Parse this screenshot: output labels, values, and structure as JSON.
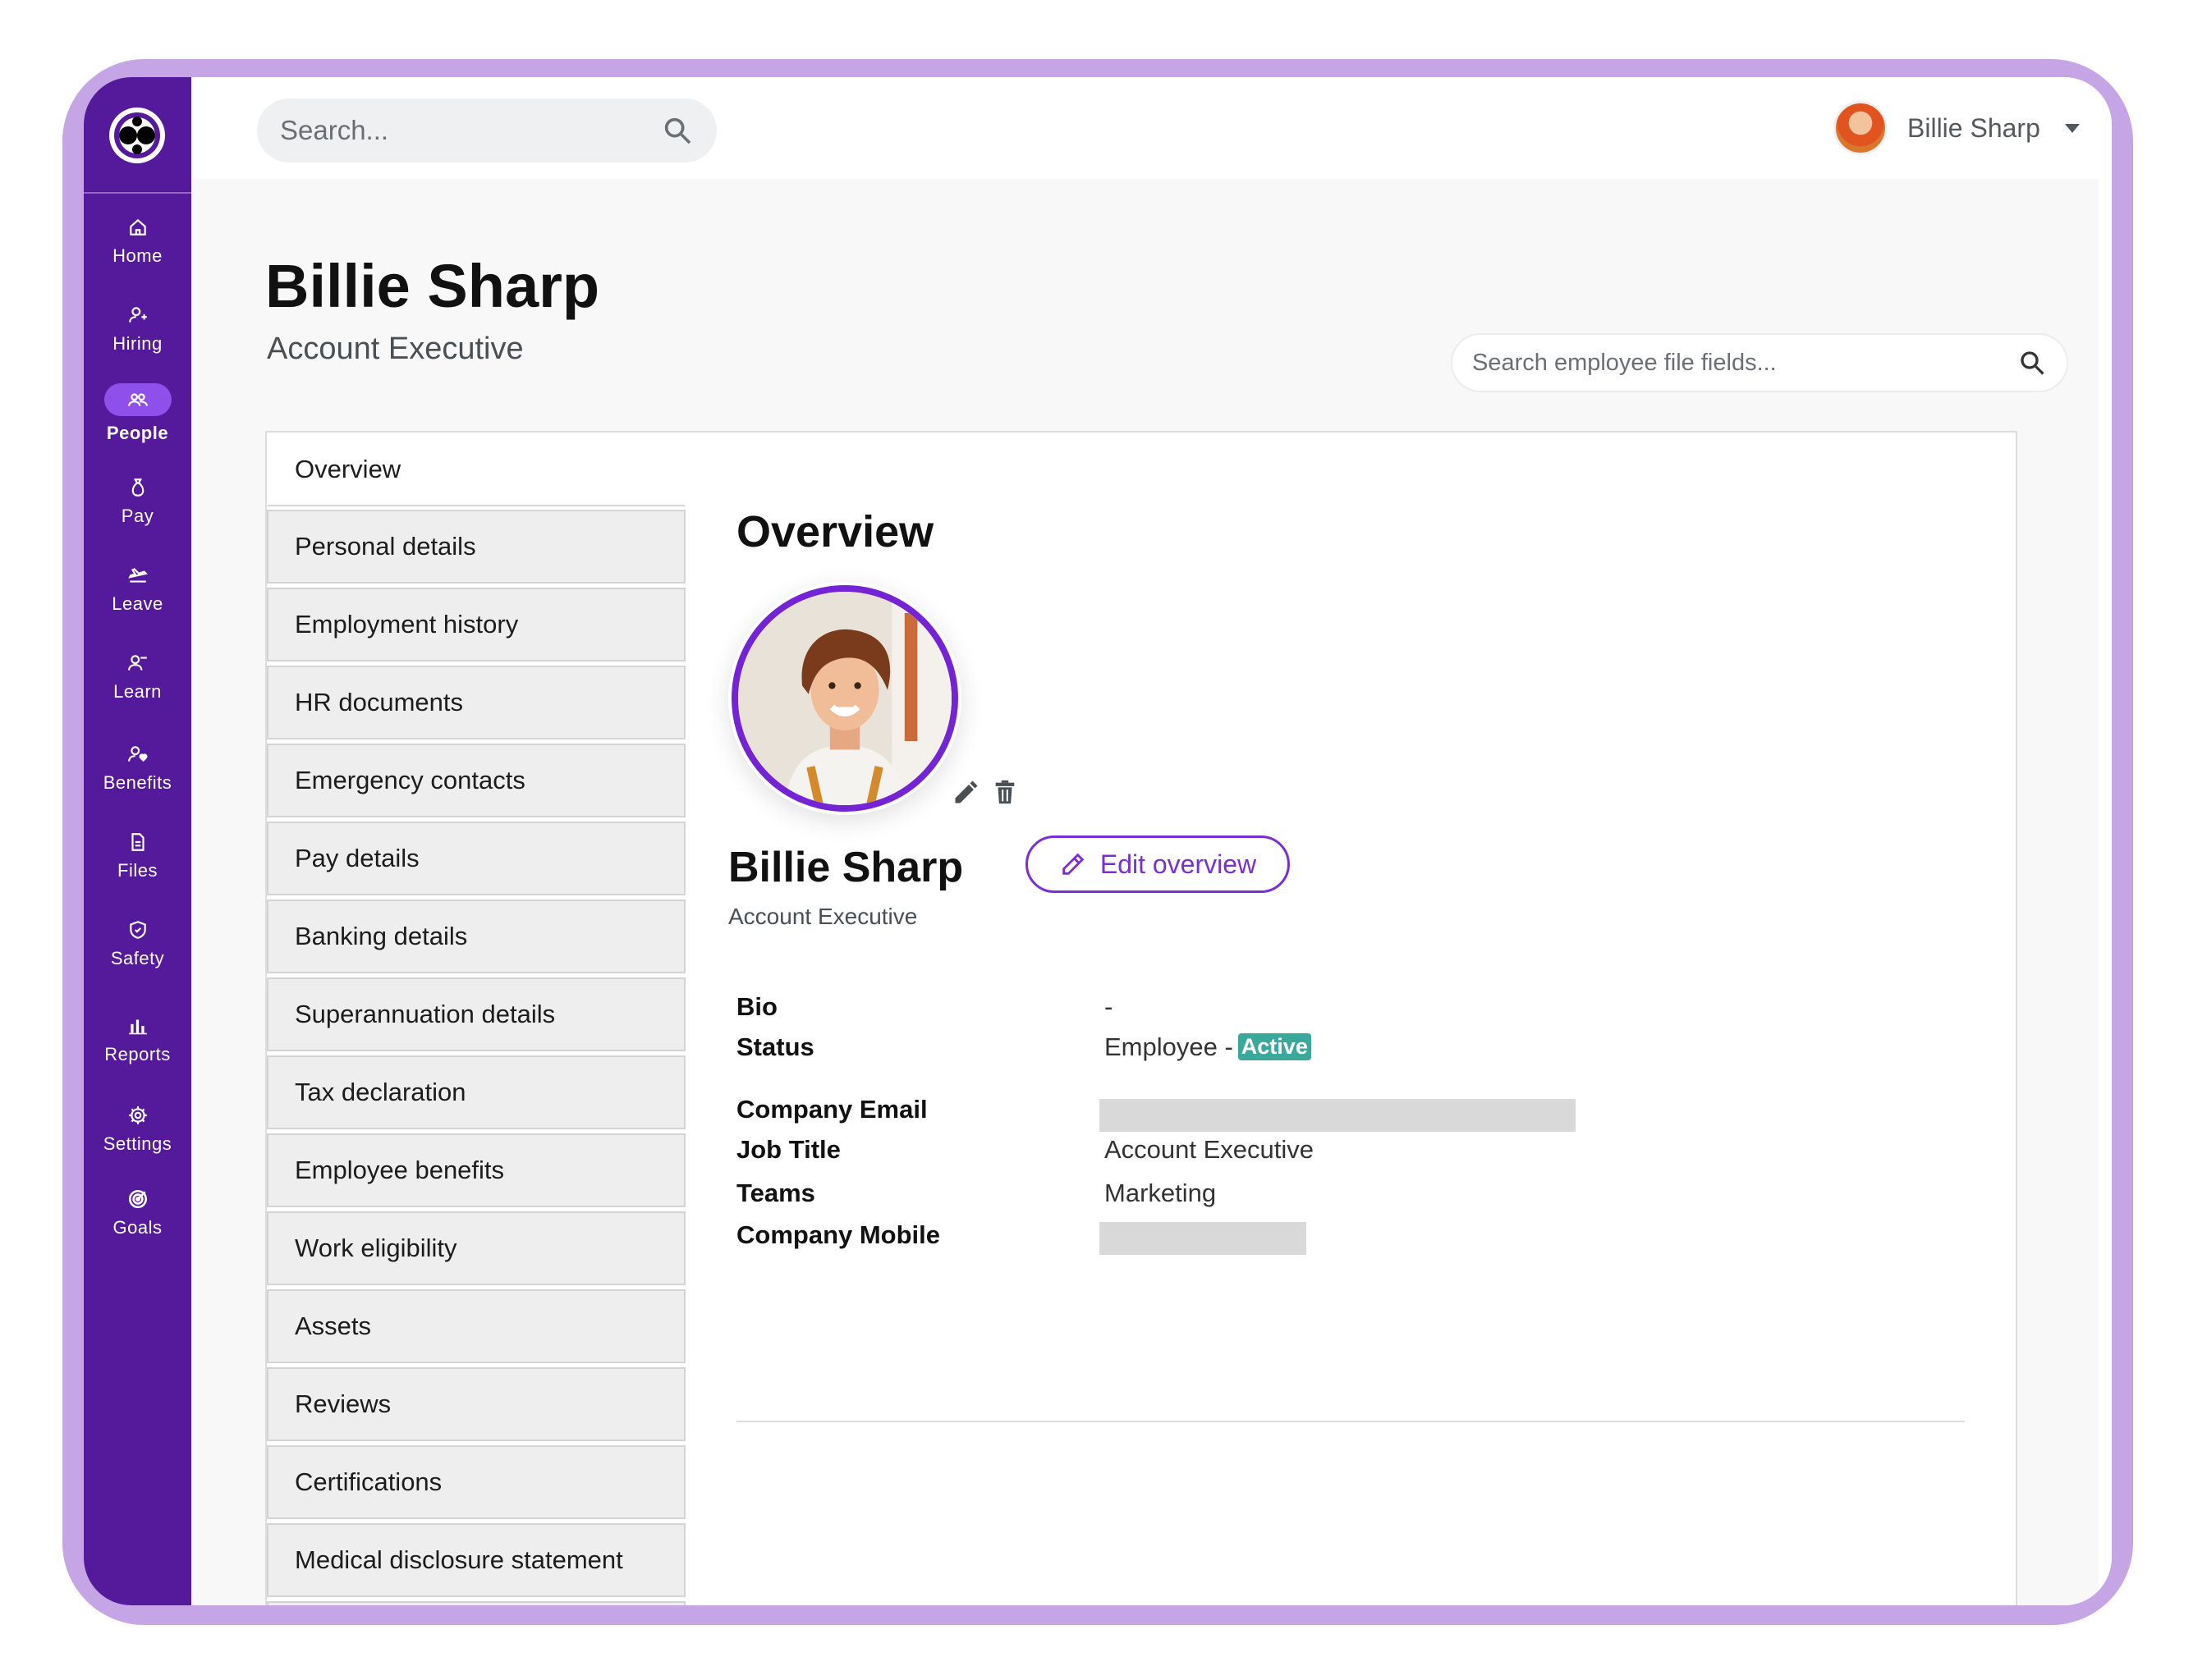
{
  "search": {
    "placeholder": "Search..."
  },
  "user": {
    "name": "Billie Sharp"
  },
  "nav": [
    {
      "label": "Home",
      "icon": "home-icon"
    },
    {
      "label": "Hiring",
      "icon": "hiring-icon"
    },
    {
      "label": "People",
      "icon": "people-icon",
      "active": true
    },
    {
      "label": "Pay",
      "icon": "money-bag-icon"
    },
    {
      "label": "Leave",
      "icon": "plane-icon"
    },
    {
      "label": "Learn",
      "icon": "learn-icon"
    },
    {
      "label": "Benefits",
      "icon": "benefits-icon"
    },
    {
      "label": "Files",
      "icon": "file-icon"
    },
    {
      "label": "Safety",
      "icon": "shield-icon"
    },
    {
      "label": "Reports",
      "icon": "bar-chart-icon"
    },
    {
      "label": "Settings",
      "icon": "gear-icon"
    },
    {
      "label": "Goals",
      "icon": "target-icon"
    }
  ],
  "page": {
    "title": "Billie Sharp",
    "subtitle": "Account Executive",
    "field_search_placeholder": "Search employee file fields..."
  },
  "tabs": [
    "Overview",
    "Personal details",
    "Employment history",
    "HR documents",
    "Emergency contacts",
    "Pay details",
    "Banking details",
    "Superannuation details",
    "Tax declaration",
    "Employee benefits",
    "Work eligibility",
    "Assets",
    "Reviews",
    "Certifications",
    "Medical disclosure statement"
  ],
  "overview": {
    "title": "Overview",
    "name": "Billie Sharp",
    "role": "Account Executive",
    "edit_label": "Edit overview",
    "fields": {
      "bio_label": "Bio",
      "bio_value": "-",
      "status_label": "Status",
      "status_value": "Employee -",
      "status_badge": "Active",
      "email_label": "Company Email",
      "job_label": "Job Title",
      "job_value": "Account Executive",
      "teams_label": "Teams",
      "teams_value": "Marketing",
      "mobile_label": "Company Mobile"
    }
  },
  "colors": {
    "sidebar": "#55199c",
    "frame": "#c5a5e6",
    "accent": "#7a2fd6",
    "active_badge": "#3aa99b"
  }
}
